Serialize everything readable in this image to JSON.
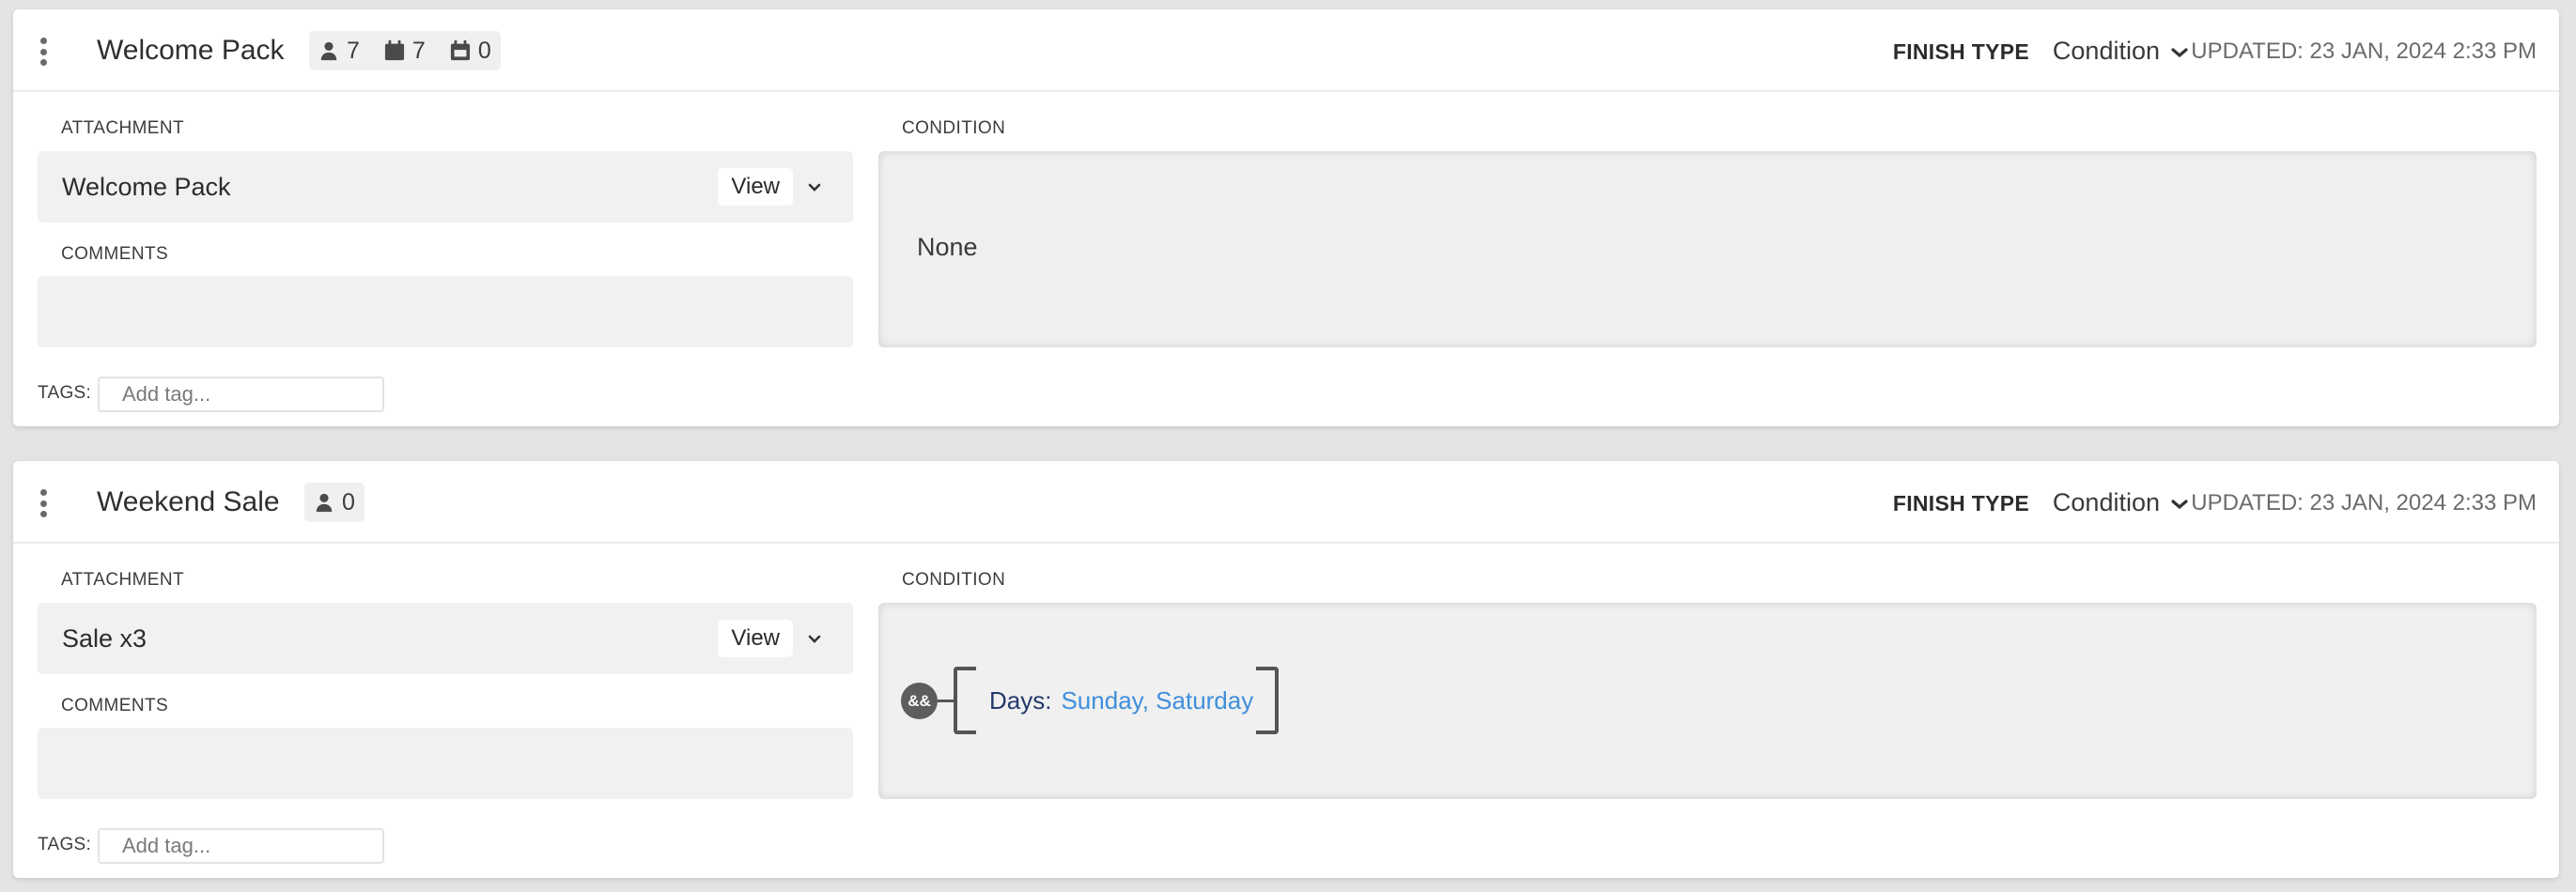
{
  "colors": {
    "background": "#e4e4e4",
    "card": "#ffffff",
    "field": "#f1f1f1",
    "condition_key": "#233a6b",
    "condition_value": "#3f8fdc",
    "and_node": "#5d5d5d"
  },
  "icons": {
    "users": "person-icon",
    "calendar": "calendar-icon",
    "calendar_check": "calendar-check-icon",
    "drag": "drag-handle-icon",
    "chevron": "chevron-down-icon"
  },
  "cards": [
    {
      "title": "Welcome Pack",
      "stats": {
        "users": "7",
        "calendar": "7",
        "scheduled": "0"
      },
      "finish_type_label": "FINISH TYPE",
      "finish_type_value": "Condition",
      "updated": "UPDATED: 23 JAN, 2024 2:33 PM",
      "attachment_label": "ATTACHMENT",
      "attachment_name": "Welcome Pack",
      "view_label": "View",
      "comments_label": "COMMENTS",
      "comments_value": "",
      "condition_label": "CONDITION",
      "condition_text": "None",
      "tags_label": "TAGS:",
      "tag_placeholder": "Add tag..."
    },
    {
      "title": "Weekend Sale",
      "stats": {
        "users": "0"
      },
      "finish_type_label": "FINISH TYPE",
      "finish_type_value": "Condition",
      "updated": "UPDATED: 23 JAN, 2024 2:33 PM",
      "attachment_label": "ATTACHMENT",
      "attachment_name": "Sale x3",
      "view_label": "View",
      "comments_label": "COMMENTS",
      "comments_value": "",
      "condition_label": "CONDITION",
      "condition": {
        "operator": "&&",
        "rule_key": "Days:",
        "rule_value": "Sunday, Saturday"
      },
      "tags_label": "TAGS:",
      "tag_placeholder": "Add tag..."
    }
  ]
}
